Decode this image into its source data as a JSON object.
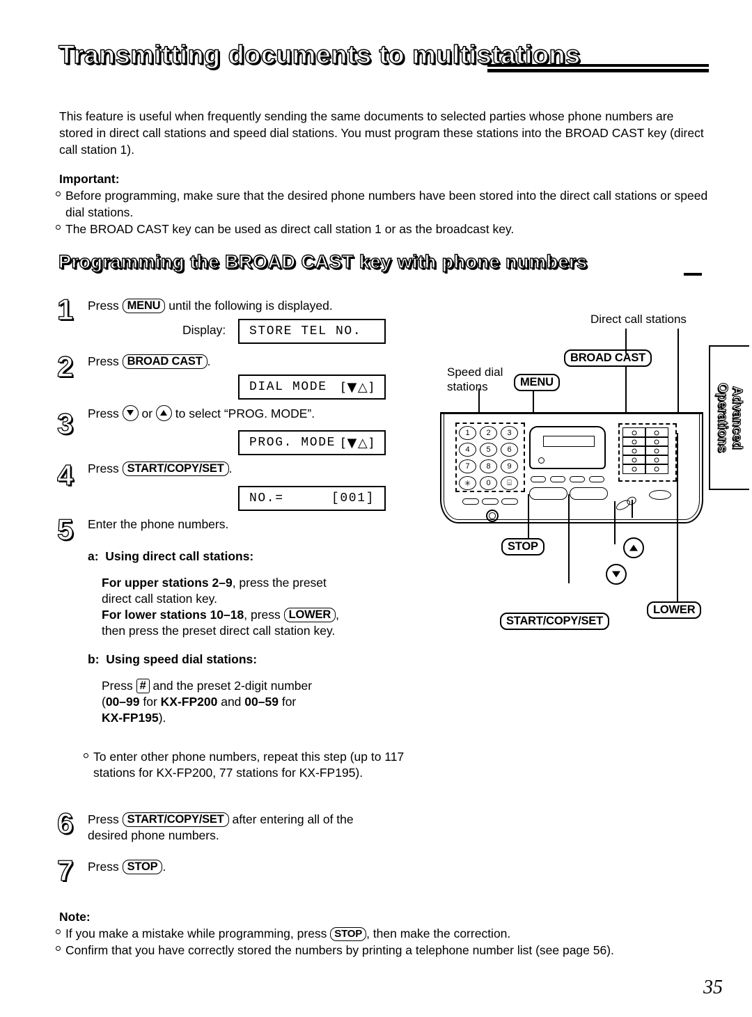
{
  "header": {
    "title": "Transmitting documents to multistations",
    "subtitle": "Programming the BROAD CAST key with phone numbers"
  },
  "intro": {
    "paragraph": "This feature is useful when frequently sending the same documents to selected parties whose phone numbers are stored in direct call stations and speed dial stations. You must program these stations into the BROAD CAST key (direct call station 1)."
  },
  "important": {
    "label": "Important:",
    "items": [
      "Before programming, make sure that the desired phone numbers have been stored into the direct call stations or speed dial stations.",
      "The BROAD CAST key can be used as direct call station 1 or as the broadcast key."
    ]
  },
  "steps": {
    "step1": {
      "number": "1",
      "text_before": "Press",
      "key": "MENU",
      "text_after": "until the following is displayed.",
      "display_label": "Display:",
      "lcd": "STORE TEL NO."
    },
    "step2": {
      "number": "2",
      "text_before": "Press",
      "key": "BROAD CAST",
      "text_after": ".",
      "lcd_left": "DIAL MODE",
      "lcd_right": "[▼△]"
    },
    "step3": {
      "number": "3",
      "text_before": "Press",
      "text_mid": "or",
      "text_after": "to select “PROG. MODE”.",
      "lcd_left": "PROG. MODE",
      "lcd_right": "[▼△]"
    },
    "step4": {
      "number": "4",
      "text_before": "Press",
      "key": "START/COPY/SET",
      "text_after": ".",
      "lcd_left": "NO.=",
      "lcd_right": "[001]"
    },
    "step5": {
      "number": "5",
      "text": "Enter the phone numbers.",
      "sub_a": {
        "marker": "a:",
        "heading": "Using direct call stations:",
        "line1_bold": "For upper stations 2–9",
        "line1_rest": ", press the preset",
        "line2": "direct call station key.",
        "line3_bold": "For lower stations 10–18",
        "line3_mid": ", press",
        "line3_key": "LOWER",
        "line3_end": ",",
        "line4": "then press the preset direct call station key."
      },
      "sub_b": {
        "marker": "b:",
        "heading": "Using speed dial stations:",
        "line1_before": "Press",
        "line1_key": "#",
        "line1_after": "and the preset 2-digit number",
        "line2_p1": "(",
        "line2_b1": "00–99",
        "line2_p2": " for ",
        "line2_b2": "KX-FP200",
        "line2_p3": " and ",
        "line2_b3": "00–59",
        "line2_p4": " for",
        "line3_b": "KX-FP195",
        "line3_p": ")."
      },
      "note_bullet": "To enter other phone numbers, repeat this step (up to 117 stations for KX-FP200, 77 stations for KX-FP195)."
    },
    "step6": {
      "number": "6",
      "text_before": "Press",
      "key": "START/COPY/SET",
      "text_after": "after entering all of the",
      "line2": "desired phone numbers."
    },
    "step7": {
      "number": "7",
      "text_before": "Press",
      "key": "STOP",
      "text_after": "."
    }
  },
  "note": {
    "label": "Note:",
    "items": [
      {
        "before": "If you make a mistake while programming, press",
        "key": "STOP",
        "after": ", then make the correction."
      },
      {
        "before": "Confirm that you have correctly stored the numbers by printing a telephone number list (see page 56).",
        "key": "",
        "after": ""
      }
    ]
  },
  "figure": {
    "labels": {
      "direct_call_stations": "Direct call stations",
      "speed_dial_line1": "Speed dial",
      "speed_dial_line2": "stations"
    },
    "keys": {
      "broad_cast": "BROAD CAST",
      "menu": "MENU",
      "stop": "STOP",
      "start_copy_set": "START/COPY/SET",
      "lower": "LOWER"
    },
    "keypad": [
      "1",
      "2",
      "3",
      "4",
      "5",
      "6",
      "7",
      "8",
      "9",
      "✳",
      "0",
      "⌸"
    ]
  },
  "side_tab": {
    "line1": "Advanced",
    "line2": "Operations"
  },
  "page_number": "35"
}
